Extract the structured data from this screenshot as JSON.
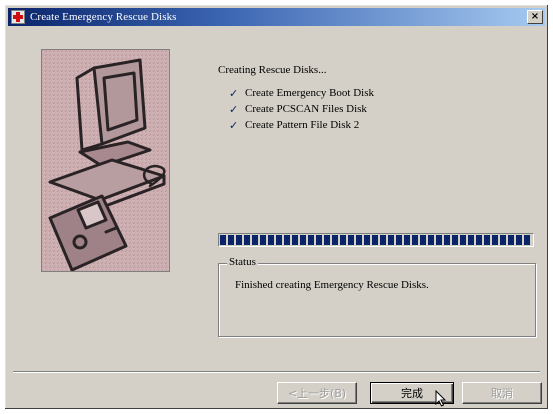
{
  "window": {
    "title": "Create Emergency Rescue Disks",
    "close_label": "×"
  },
  "main": {
    "heading": "Creating Rescue Disks...",
    "steps": [
      {
        "label": "Create Emergency Boot Disk",
        "icon": "checkmark-icon",
        "check": "✓"
      },
      {
        "label": "Create PCSCAN Files Disk",
        "icon": "checkmark-icon",
        "check": "✓"
      },
      {
        "label": "Create Pattern File Disk 2",
        "icon": "checkmark-icon",
        "check": "✓"
      }
    ],
    "progress_percent": 100
  },
  "status": {
    "legend": "Status",
    "message": "Finished creating Emergency Rescue Disks."
  },
  "buttons": {
    "back": "<上一步(B)",
    "finish": "完成",
    "cancel": "取消"
  },
  "colors": {
    "title_gradient_start": "#0a246a",
    "title_gradient_end": "#a6caf0",
    "dialog_face": "#d4d0c8",
    "progress_blocks": "#0a246a"
  }
}
